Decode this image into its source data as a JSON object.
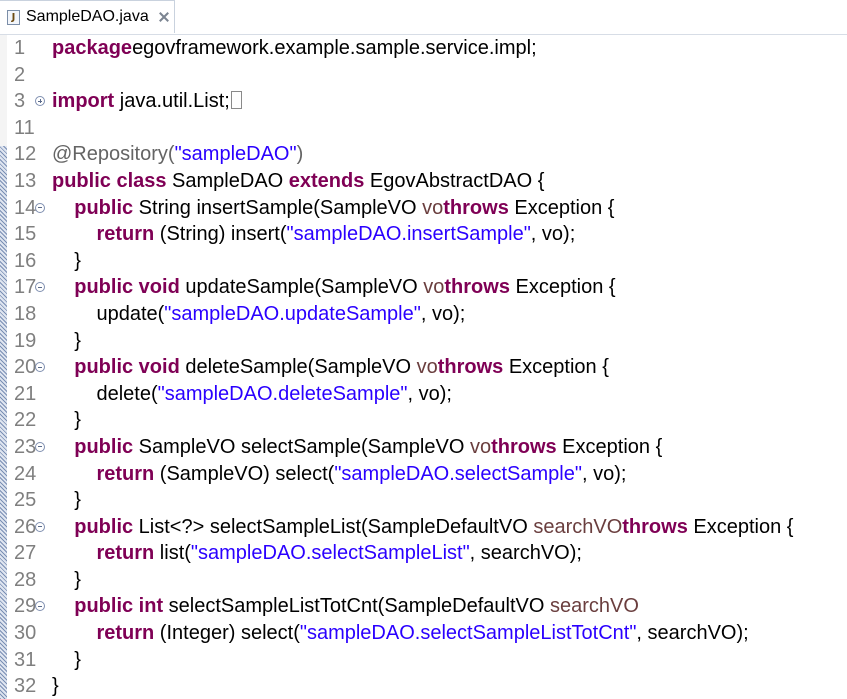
{
  "tab": {
    "title": "SampleDAO.java",
    "icon": "java-file-icon",
    "close": "close-icon"
  },
  "colors": {
    "keyword": "#7f0055",
    "string": "#2a00ff",
    "annotation": "#646464",
    "param": "#6a3e3e",
    "line_number": "#7f7f7f"
  },
  "lines": [
    {
      "n": "1",
      "fold": "",
      "tokens": [
        [
          "kw",
          "package"
        ],
        [
          "",
          "egovframework.example.sample.service.impl;"
        ]
      ]
    },
    {
      "n": "2",
      "fold": "",
      "tokens": []
    },
    {
      "n": "3",
      "fold": "plus",
      "tokens": [
        [
          "kw",
          "import"
        ],
        [
          "",
          " java.util.List;"
        ],
        [
          "marker",
          ""
        ]
      ]
    },
    {
      "n": "11",
      "fold": "",
      "tokens": []
    },
    {
      "n": "12",
      "fold": "",
      "tokens": [
        [
          "ann",
          "@Repository("
        ],
        [
          "str",
          "\"sampleDAO\""
        ],
        [
          "ann",
          ")"
        ]
      ]
    },
    {
      "n": "13",
      "fold": "",
      "tokens": [
        [
          "kw",
          "public class"
        ],
        [
          "",
          " SampleDAO "
        ],
        [
          "kw",
          "extends"
        ],
        [
          "",
          " EgovAbstractDAO {"
        ]
      ]
    },
    {
      "n": "14",
      "fold": "minus",
      "tokens": [
        [
          "",
          "    "
        ],
        [
          "kw",
          "public"
        ],
        [
          "",
          " String insertSample(SampleVO "
        ],
        [
          "param",
          "vo"
        ],
        [
          ") "
        ],
        [
          "kw",
          "throws"
        ],
        [
          "",
          " Exception {"
        ]
      ]
    },
    {
      "n": "15",
      "fold": "",
      "tokens": [
        [
          "",
          "        "
        ],
        [
          "kw",
          "return"
        ],
        [
          "",
          " (String) insert("
        ],
        [
          "str",
          "\"sampleDAO.insertSample\""
        ],
        [
          "",
          ", vo);"
        ]
      ]
    },
    {
      "n": "16",
      "fold": "",
      "tokens": [
        [
          "",
          "    }"
        ]
      ]
    },
    {
      "n": "17",
      "fold": "minus",
      "tokens": [
        [
          "",
          "    "
        ],
        [
          "kw",
          "public void"
        ],
        [
          "",
          " updateSample(SampleVO "
        ],
        [
          "param",
          "vo"
        ],
        [
          ") "
        ],
        [
          "kw",
          "throws"
        ],
        [
          "",
          " Exception {"
        ]
      ]
    },
    {
      "n": "18",
      "fold": "",
      "tokens": [
        [
          "",
          "        update("
        ],
        [
          "str",
          "\"sampleDAO.updateSample\""
        ],
        [
          "",
          ", vo);"
        ]
      ]
    },
    {
      "n": "19",
      "fold": "",
      "tokens": [
        [
          "",
          "    }"
        ]
      ]
    },
    {
      "n": "20",
      "fold": "minus",
      "tokens": [
        [
          "",
          "    "
        ],
        [
          "kw",
          "public void"
        ],
        [
          "",
          " deleteSample(SampleVO "
        ],
        [
          "param",
          "vo"
        ],
        [
          ") "
        ],
        [
          "kw",
          "throws"
        ],
        [
          "",
          " Exception {"
        ]
      ]
    },
    {
      "n": "21",
      "fold": "",
      "tokens": [
        [
          "",
          "        delete("
        ],
        [
          "str",
          "\"sampleDAO.deleteSample\""
        ],
        [
          "",
          ", vo);"
        ]
      ]
    },
    {
      "n": "22",
      "fold": "",
      "tokens": [
        [
          "",
          "    }"
        ]
      ]
    },
    {
      "n": "23",
      "fold": "minus",
      "tokens": [
        [
          "",
          "    "
        ],
        [
          "kw",
          "public"
        ],
        [
          "",
          " SampleVO selectSample(SampleVO "
        ],
        [
          "param",
          "vo"
        ],
        [
          ") "
        ],
        [
          "kw",
          "throws"
        ],
        [
          "",
          " Exception {"
        ]
      ]
    },
    {
      "n": "24",
      "fold": "",
      "tokens": [
        [
          "",
          "        "
        ],
        [
          "kw",
          "return"
        ],
        [
          "",
          " (SampleVO) select("
        ],
        [
          "str",
          "\"sampleDAO.selectSample\""
        ],
        [
          "",
          ", vo);"
        ]
      ]
    },
    {
      "n": "25",
      "fold": "",
      "tokens": [
        [
          "",
          "    }"
        ]
      ]
    },
    {
      "n": "26",
      "fold": "minus",
      "tokens": [
        [
          "",
          "    "
        ],
        [
          "kw",
          "public"
        ],
        [
          "",
          " List<?> selectSampleList(SampleDefaultVO "
        ],
        [
          "param",
          "searchVO"
        ],
        [
          ") "
        ],
        [
          "kw",
          "throws"
        ],
        [
          "",
          " Exception {"
        ]
      ]
    },
    {
      "n": "27",
      "fold": "",
      "tokens": [
        [
          "",
          "        "
        ],
        [
          "kw",
          "return"
        ],
        [
          "",
          " list("
        ],
        [
          "str",
          "\"sampleDAO.selectSampleList\""
        ],
        [
          "",
          ", searchVO);"
        ]
      ]
    },
    {
      "n": "28",
      "fold": "",
      "tokens": [
        [
          "",
          "    }"
        ]
      ]
    },
    {
      "n": "29",
      "fold": "minus",
      "tokens": [
        [
          "",
          "    "
        ],
        [
          "kw",
          "public int"
        ],
        [
          "",
          " selectSampleListTotCnt(SampleDefaultVO "
        ],
        [
          "param",
          "searchVO"
        ],
        [
          ") {"
        ]
      ]
    },
    {
      "n": "30",
      "fold": "",
      "tokens": [
        [
          "",
          "        "
        ],
        [
          "kw",
          "return"
        ],
        [
          "",
          " (Integer) select("
        ],
        [
          "str",
          "\"sampleDAO.selectSampleListTotCnt\""
        ],
        [
          "",
          ", searchVO);"
        ]
      ]
    },
    {
      "n": "31",
      "fold": "",
      "tokens": [
        [
          "",
          "    }"
        ]
      ]
    },
    {
      "n": "32",
      "fold": "",
      "tokens": [
        [
          "",
          "}"
        ]
      ]
    }
  ]
}
